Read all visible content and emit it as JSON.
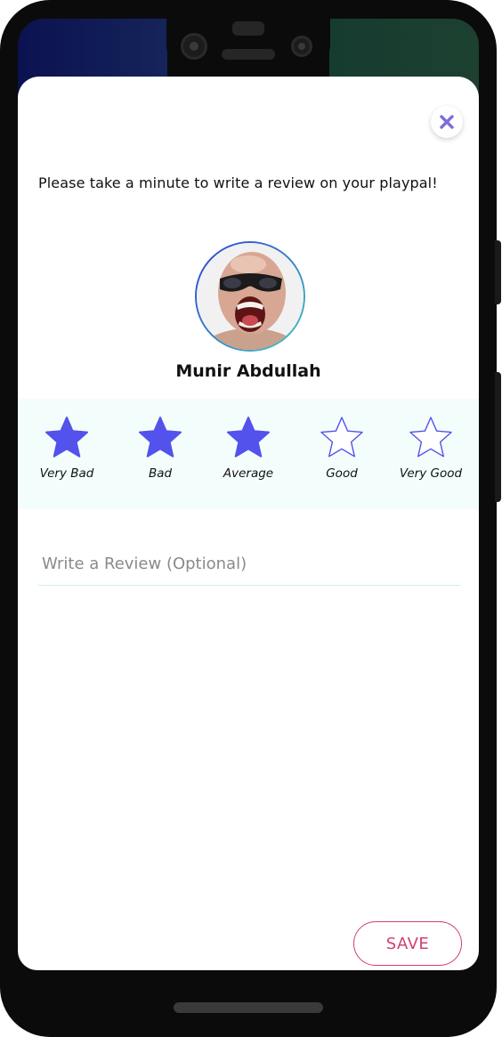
{
  "review": {
    "prompt": "Please take a minute to write a review on your playpal!",
    "user_name": "Munir Abdullah",
    "selected_rating": 3,
    "max_rating": 5,
    "ratings": [
      {
        "label": "Very Bad",
        "filled": true
      },
      {
        "label": "Bad",
        "filled": true
      },
      {
        "label": "Average",
        "filled": true
      },
      {
        "label": "Good",
        "filled": false
      },
      {
        "label": "Very Good",
        "filled": false
      }
    ],
    "review_placeholder": "Write a Review (Optional)",
    "review_value": "",
    "save_label": "SAVE"
  },
  "colors": {
    "star": "#5352ec",
    "close": "#7a6fd8",
    "save": "#d0406e",
    "rating_band": "#f3fefc",
    "input_underline": "#cdeee6"
  },
  "icons": {
    "close": "close-icon",
    "star_filled": "star-filled-icon",
    "star_empty": "star-outline-icon"
  }
}
